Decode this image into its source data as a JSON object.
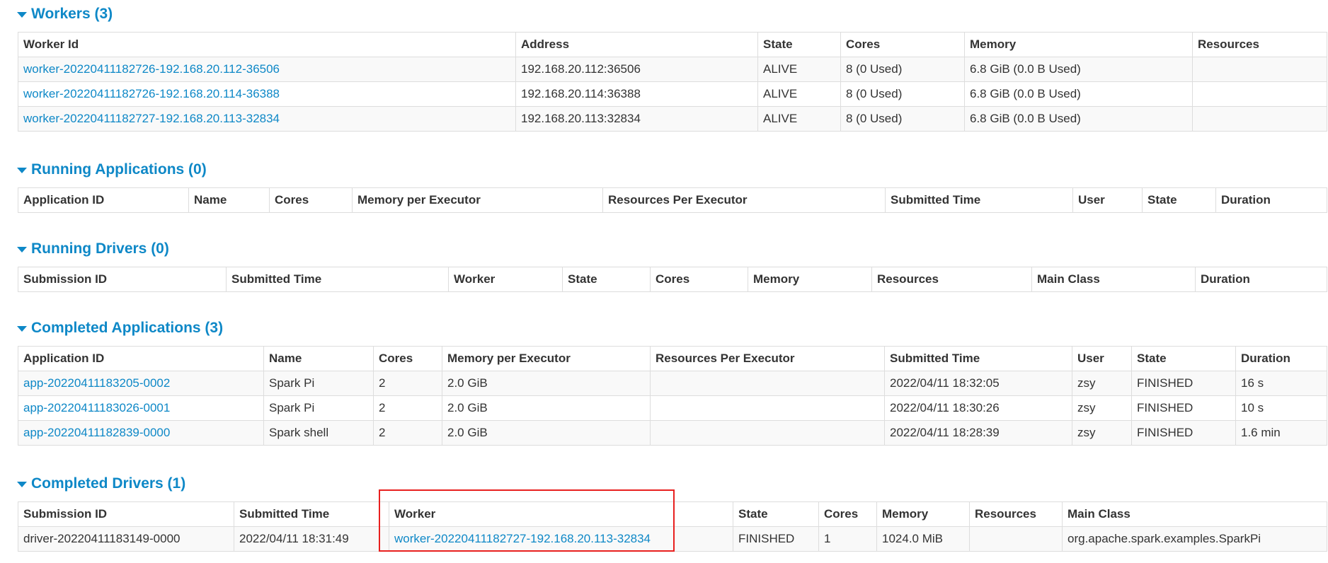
{
  "colors": {
    "link": "#0e88c7",
    "highlight": "#e8201f",
    "row_stripe": "#f9f9f9",
    "border": "#dddddd"
  },
  "workers": {
    "heading": "Workers (3)",
    "headers": [
      "Worker Id",
      "Address",
      "State",
      "Cores",
      "Memory",
      "Resources"
    ],
    "rows": [
      [
        "worker-20220411182726-192.168.20.112-36506",
        "192.168.20.112:36506",
        "ALIVE",
        "8 (0 Used)",
        "6.8 GiB (0.0 B Used)",
        ""
      ],
      [
        "worker-20220411182726-192.168.20.114-36388",
        "192.168.20.114:36388",
        "ALIVE",
        "8 (0 Used)",
        "6.8 GiB (0.0 B Used)",
        ""
      ],
      [
        "worker-20220411182727-192.168.20.113-32834",
        "192.168.20.113:32834",
        "ALIVE",
        "8 (0 Used)",
        "6.8 GiB (0.0 B Used)",
        ""
      ]
    ]
  },
  "running_apps": {
    "heading": "Running Applications (0)",
    "headers": [
      "Application ID",
      "Name",
      "Cores",
      "Memory per Executor",
      "Resources Per Executor",
      "Submitted Time",
      "User",
      "State",
      "Duration"
    ]
  },
  "running_drivers": {
    "heading": "Running Drivers (0)",
    "headers": [
      "Submission ID",
      "Submitted Time",
      "Worker",
      "State",
      "Cores",
      "Memory",
      "Resources",
      "Main Class",
      "Duration"
    ]
  },
  "completed_apps": {
    "heading": "Completed Applications (3)",
    "headers": [
      "Application ID",
      "Name",
      "Cores",
      "Memory per Executor",
      "Resources Per Executor",
      "Submitted Time",
      "User",
      "State",
      "Duration"
    ],
    "rows": [
      [
        "app-20220411183205-0002",
        "Spark Pi",
        "2",
        "2.0 GiB",
        "",
        "2022/04/11 18:32:05",
        "zsy",
        "FINISHED",
        "16 s"
      ],
      [
        "app-20220411183026-0001",
        "Spark Pi",
        "2",
        "2.0 GiB",
        "",
        "2022/04/11 18:30:26",
        "zsy",
        "FINISHED",
        "10 s"
      ],
      [
        "app-20220411182839-0000",
        "Spark shell",
        "2",
        "2.0 GiB",
        "",
        "2022/04/11 18:28:39",
        "zsy",
        "FINISHED",
        "1.6 min"
      ]
    ]
  },
  "completed_drivers": {
    "heading": "Completed Drivers (1)",
    "headers": [
      "Submission ID",
      "Submitted Time",
      "Worker",
      "State",
      "Cores",
      "Memory",
      "Resources",
      "Main Class"
    ],
    "rows": [
      [
        "driver-20220411183149-0000",
        "2022/04/11 18:31:49",
        "worker-20220411182727-192.168.20.113-32834",
        "FINISHED",
        "1",
        "1024.0 MiB",
        "",
        "org.apache.spark.examples.SparkPi"
      ]
    ]
  }
}
